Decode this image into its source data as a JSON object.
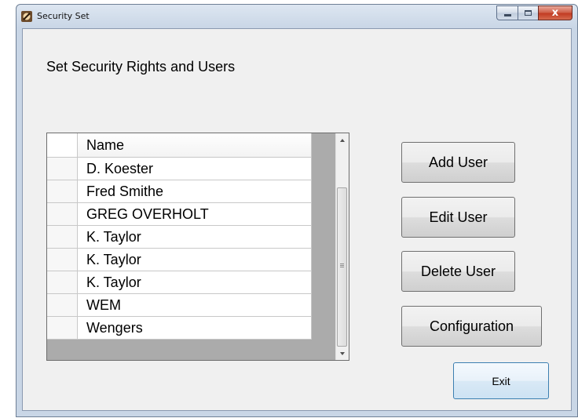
{
  "window": {
    "title": "Security Set",
    "icon": "app-icon"
  },
  "caption": {
    "minimize_icon": "minimize-icon",
    "maximize_icon": "maximize-icon",
    "close_icon": "close-icon",
    "close_glyph": "x"
  },
  "heading": "Set Security Rights and Users",
  "grid": {
    "column_header": "Name",
    "rows": [
      "D. Koester",
      "Fred Smithe",
      "GREG OVERHOLT",
      "K. Taylor",
      "K. Taylor",
      "K. Taylor",
      "WEM",
      "Wengers"
    ]
  },
  "buttons": {
    "add": "Add User",
    "edit": "Edit User",
    "delete": "Delete User",
    "config": "Configuration",
    "exit": "Exit"
  },
  "colors": {
    "close_button": "#c23c23",
    "exit_border": "#3c7fb1",
    "grid_background": "#ababab"
  }
}
